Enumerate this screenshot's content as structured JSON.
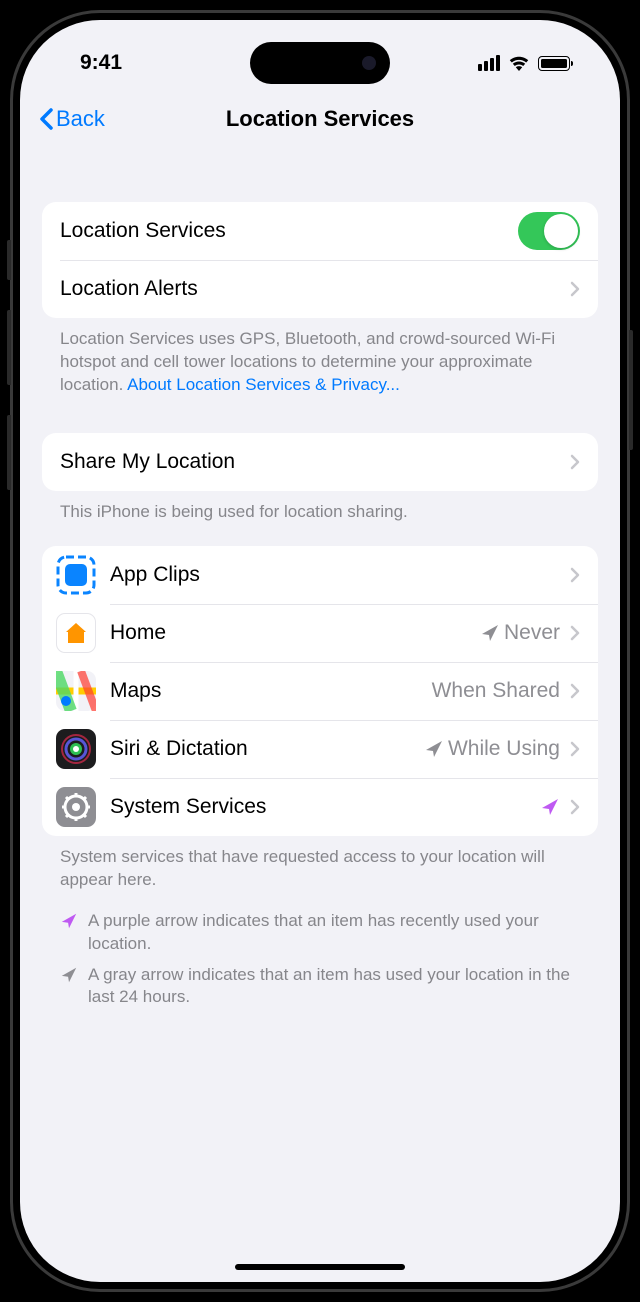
{
  "status": {
    "time": "9:41"
  },
  "nav": {
    "back": "Back",
    "title": "Location Services"
  },
  "rows": {
    "location_services": "Location Services",
    "location_alerts": "Location Alerts",
    "share_my_location": "Share My Location"
  },
  "group1_footer": {
    "text": "Location Services uses GPS, Bluetooth, and crowd-sourced Wi-Fi hotspot and cell tower locations to determine your approximate location. ",
    "link": "About Location Services & Privacy..."
  },
  "group2_footer": "This iPhone is being used for location sharing.",
  "apps": [
    {
      "name": "App Clips",
      "value": "",
      "indicator": ""
    },
    {
      "name": "Home",
      "value": "Never",
      "indicator": "gray"
    },
    {
      "name": "Maps",
      "value": "When Shared",
      "indicator": ""
    },
    {
      "name": "Siri & Dictation",
      "value": "While Using",
      "indicator": "gray"
    },
    {
      "name": "System Services",
      "value": "",
      "indicator": "purple"
    }
  ],
  "apps_footer": "System services that have requested access to your location will appear here.",
  "legend": {
    "purple": "A purple arrow indicates that an item has recently used your location.",
    "gray": "A gray arrow indicates that an item has used your location in the last 24 hours."
  }
}
